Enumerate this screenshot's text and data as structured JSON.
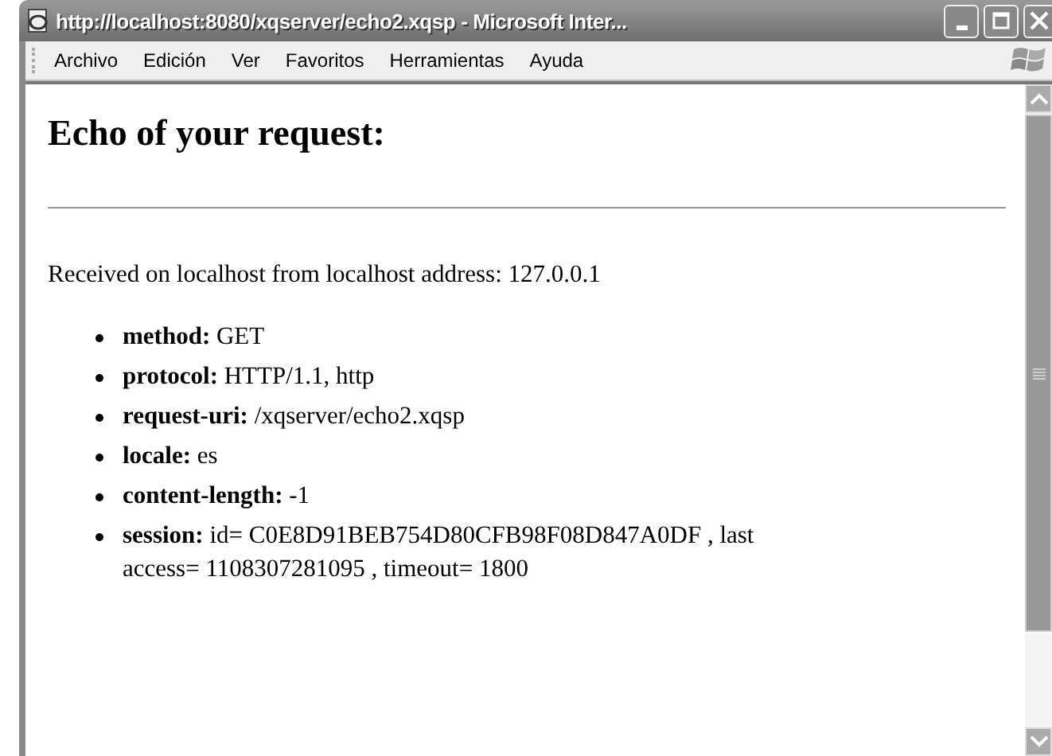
{
  "window": {
    "title": "http://localhost:8080/xqserver/echo2.xqsp - Microsoft Inter..."
  },
  "menu": [
    "Archivo",
    "Edición",
    "Ver",
    "Favoritos",
    "Herramientas",
    "Ayuda"
  ],
  "page": {
    "heading": "Echo of your request:",
    "received": "Received on localhost from localhost address: 127.0.0.1",
    "fields": [
      "**method:** GET",
      "**protocol:** HTTP/1.1, http",
      "**request-uri:** /xqserver/echo2.xqsp",
      "**locale:** es",
      "**content-length:** -1",
      "**session:** id= C0E8D91BEB754D80CFB98F08D847A0DF , last access= 1108307281095 , timeout= 1800"
    ]
  }
}
